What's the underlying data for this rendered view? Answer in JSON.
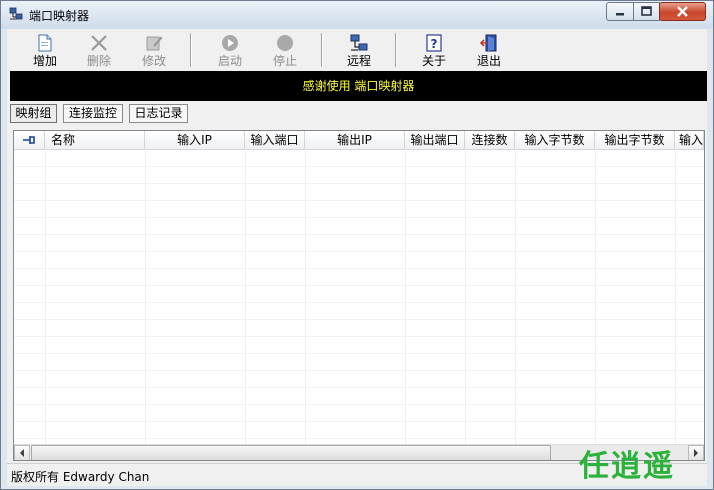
{
  "window": {
    "title": "端口映射器"
  },
  "toolbar": {
    "buttons": [
      {
        "label": "增加",
        "icon": "add-document-icon",
        "enabled": true
      },
      {
        "label": "删除",
        "icon": "delete-x-icon",
        "enabled": false
      },
      {
        "label": "修改",
        "icon": "edit-icon",
        "enabled": false
      },
      {
        "label": "启动",
        "icon": "play-icon",
        "enabled": false
      },
      {
        "label": "停止",
        "icon": "stop-icon",
        "enabled": false
      },
      {
        "label": "远程",
        "icon": "remote-network-icon",
        "enabled": true
      },
      {
        "label": "关于",
        "icon": "help-icon",
        "enabled": true
      },
      {
        "label": "退出",
        "icon": "exit-door-icon",
        "enabled": true
      }
    ]
  },
  "banner": {
    "text": "感谢使用 端口映射器",
    "bg": "#000000",
    "fg": "#ffff33"
  },
  "tabs": [
    {
      "label": "映射组",
      "active": true
    },
    {
      "label": "连接监控",
      "active": false
    },
    {
      "label": "日志记录",
      "active": false
    }
  ],
  "table": {
    "columns": [
      "名称",
      "输入IP",
      "输入端口",
      "输出IP",
      "输出端口",
      "连接数",
      "输入字节数",
      "输出字节数",
      "输入"
    ],
    "rows": []
  },
  "status": {
    "text": "版权所有 Edwardy Chan"
  },
  "watermark": {
    "text": "任逍遥"
  },
  "colors": {
    "watermark": "#2bb23a",
    "close_button": "#c7462b"
  }
}
